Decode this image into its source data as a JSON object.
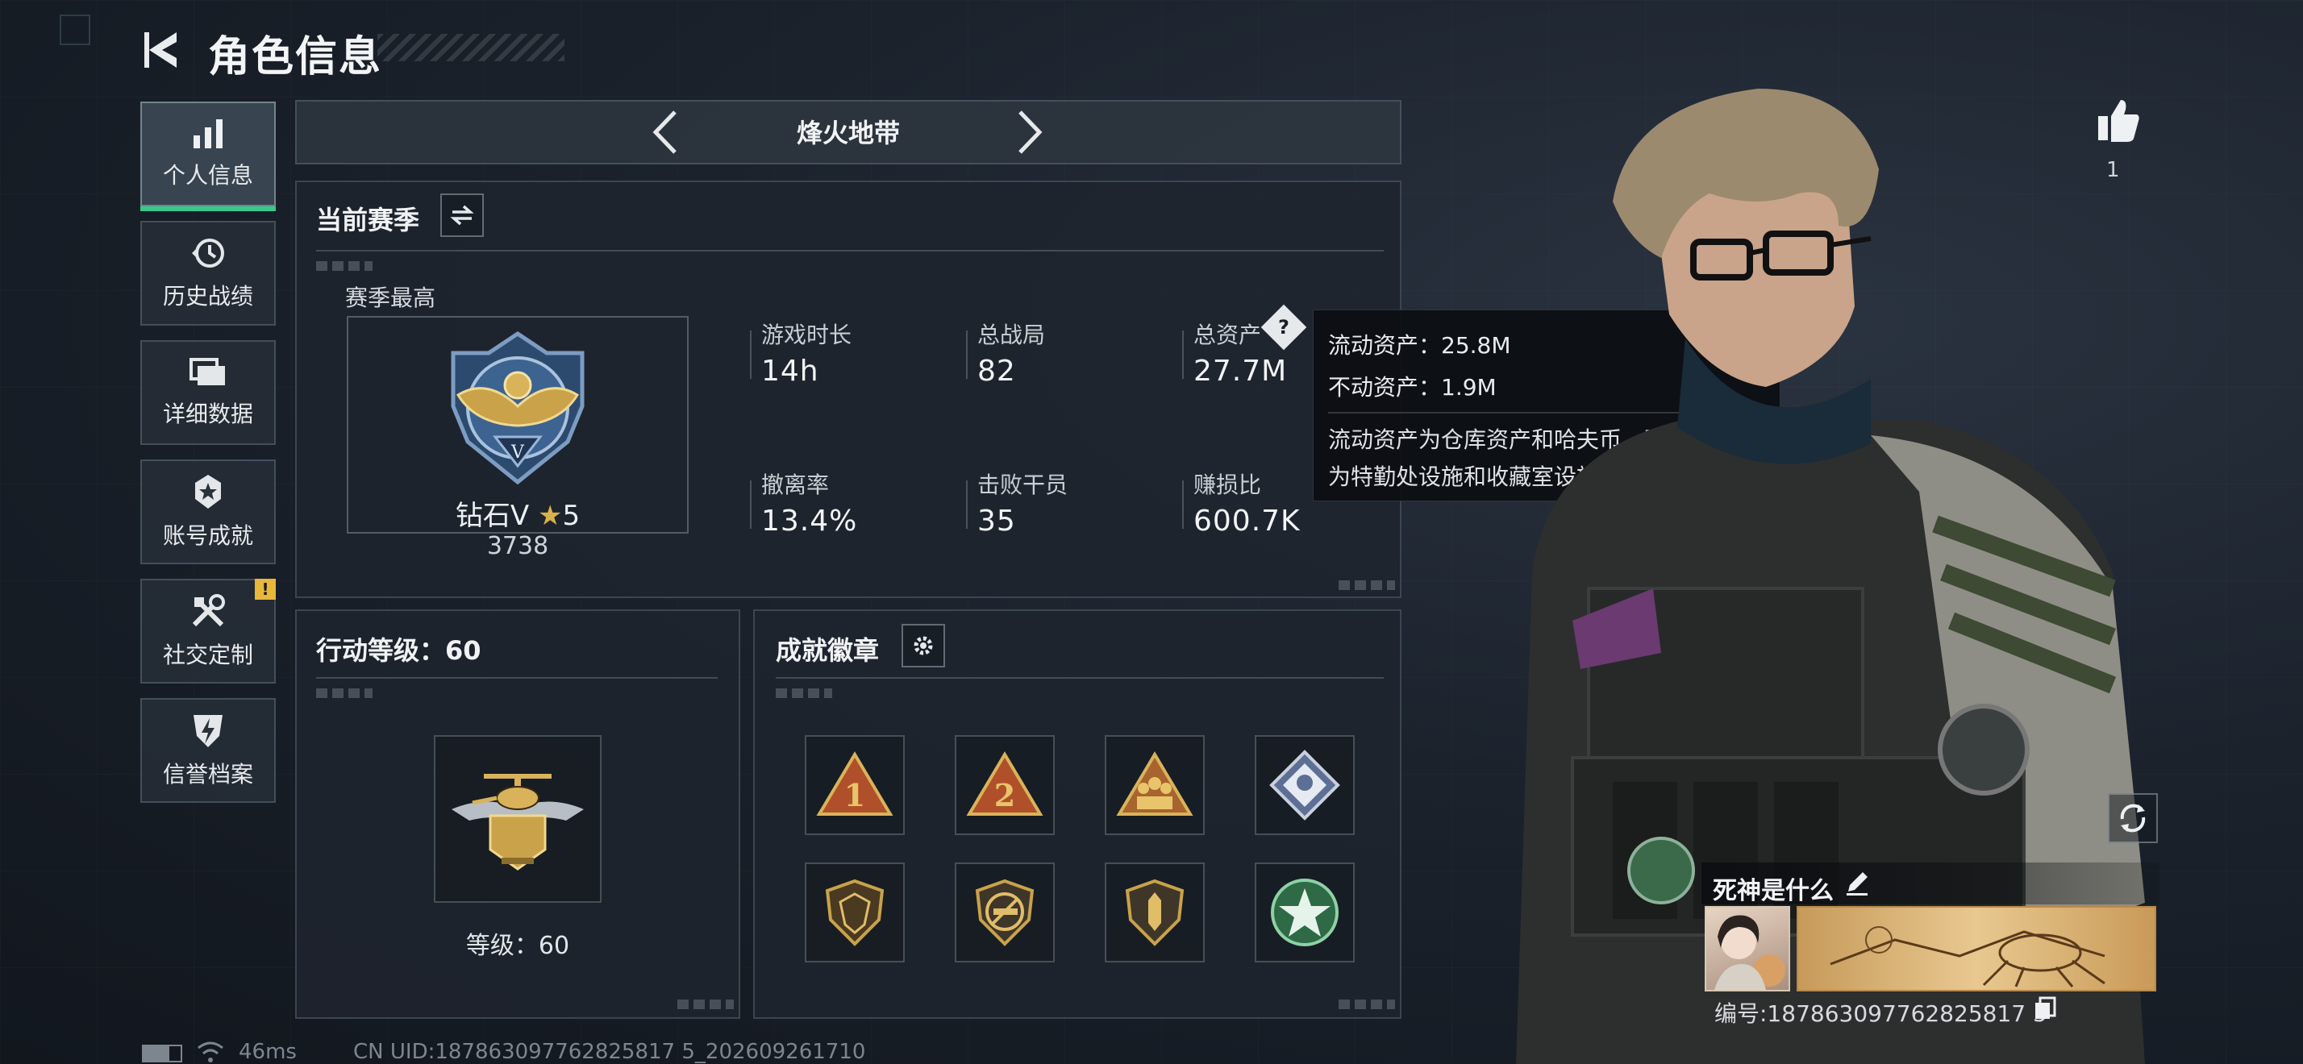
{
  "header": {
    "title": "角色信息"
  },
  "sidebar": {
    "items": [
      {
        "label": "个人信息"
      },
      {
        "label": "历史战绩"
      },
      {
        "label": "详细数据"
      },
      {
        "label": "账号成就"
      },
      {
        "label": "社交定制",
        "badge": "!"
      },
      {
        "label": "信誉档案"
      }
    ]
  },
  "mode": {
    "label": "烽火地带"
  },
  "season": {
    "title": "当前赛季",
    "best_label": "赛季最高",
    "rank_name": "钻石V",
    "rank_star": "★",
    "rank_stars": "5",
    "rank_points": "3738",
    "stats": [
      {
        "label": "游戏时长",
        "value": "14h"
      },
      {
        "label": "总战局",
        "value": "82"
      },
      {
        "label": "总资产",
        "value": "27.7M"
      },
      {
        "label": "撤离率",
        "value": "13.4%"
      },
      {
        "label": "击败干员",
        "value": "35"
      },
      {
        "label": "赚损比",
        "value": "600.7K"
      }
    ]
  },
  "tooltip": {
    "liquid": "流动资产：25.8M",
    "fixed": "不动资产：1.9M",
    "desc_line1": "流动资产为仓库资产和哈夫币，不动资产",
    "desc_line2": "为特勤处设施和收藏室设施"
  },
  "level": {
    "title": "行动等级：60",
    "caption": "等级：60"
  },
  "achievements": {
    "title": "成就徽章",
    "badges": [
      "badge-1-icon",
      "badge-2-icon",
      "badge-squad-icon",
      "badge-emblem-icon",
      "badge-shield-icon",
      "badge-no-gun-icon",
      "badge-knife-icon",
      "badge-star-icon"
    ]
  },
  "profile": {
    "likes": "1",
    "name": "死神是什么",
    "id": "编号:187863097762825817 5"
  },
  "status": {
    "ping": "46ms",
    "uid": "CN UID:187863097762825817 5_202609261710"
  },
  "colors": {
    "accent_green": "#38c98a",
    "warn_yellow": "#e8b83a",
    "gold": "#c9a24a"
  }
}
